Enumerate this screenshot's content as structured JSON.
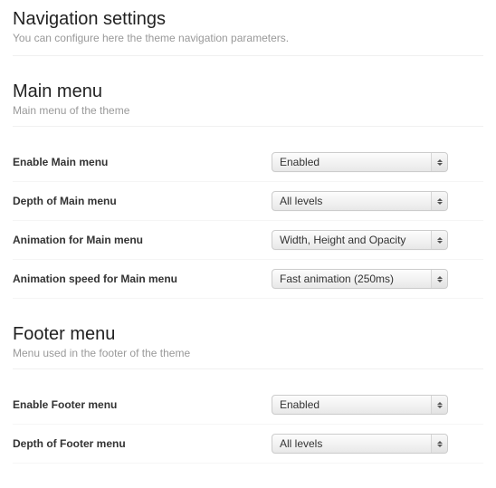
{
  "page": {
    "title": "Navigation settings",
    "description": "You can configure here the theme navigation parameters."
  },
  "groups": {
    "main_menu": {
      "title": "Main menu",
      "description": "Main menu of the theme",
      "fields": {
        "enable": {
          "label": "Enable Main menu",
          "value": "Enabled"
        },
        "depth": {
          "label": "Depth of Main menu",
          "value": "All levels"
        },
        "animation": {
          "label": "Animation for Main menu",
          "value": "Width, Height and Opacity"
        },
        "animation_speed": {
          "label": "Animation speed for Main menu",
          "value": "Fast animation (250ms)"
        }
      }
    },
    "footer_menu": {
      "title": "Footer menu",
      "description": "Menu used in the footer of the theme",
      "fields": {
        "enable": {
          "label": "Enable Footer menu",
          "value": "Enabled"
        },
        "depth": {
          "label": "Depth of Footer menu",
          "value": "All levels"
        }
      }
    }
  }
}
